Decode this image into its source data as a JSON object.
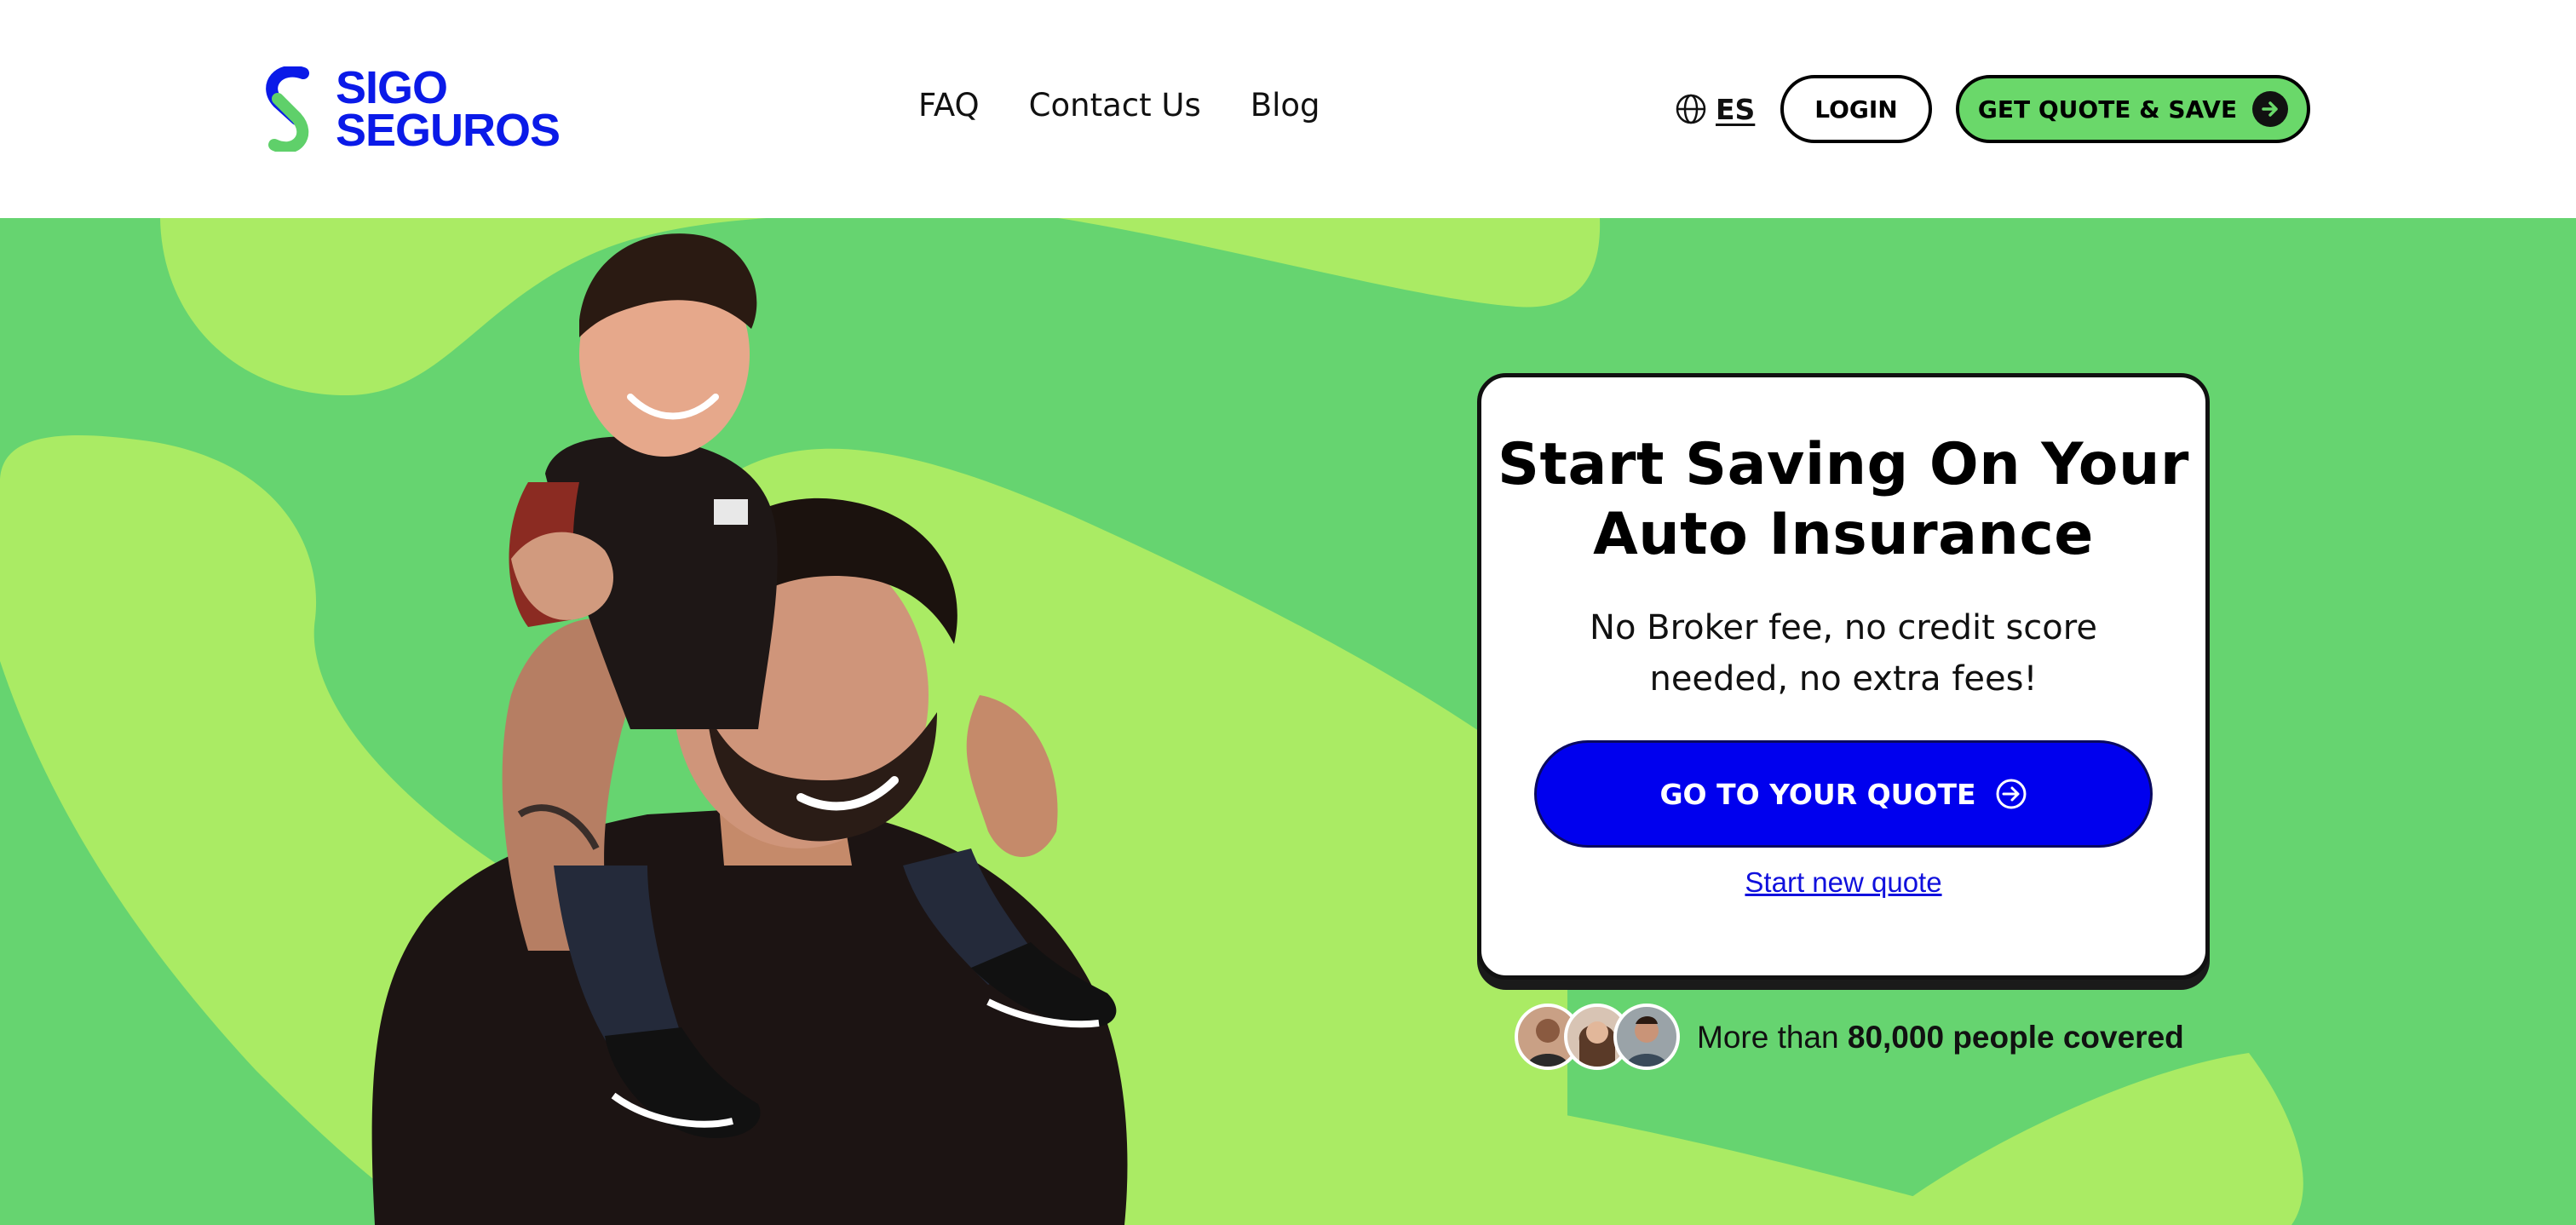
{
  "brand": {
    "line1": "SIGO",
    "line2": "SEGUROS"
  },
  "nav": [
    {
      "label": "FAQ"
    },
    {
      "label": "Contact Us"
    },
    {
      "label": "Blog"
    }
  ],
  "language": {
    "label": "ES",
    "icon": "globe-icon"
  },
  "header_buttons": {
    "login": "LOGIN",
    "quote": "GET QUOTE & SAVE",
    "quote_icon": "arrow-right-circle-icon"
  },
  "card": {
    "title_line1": "Start Saving On Your",
    "title_line2": "Auto Insurance",
    "subtitle_line1": "No Broker fee, no credit score",
    "subtitle_line2": "needed, no extra fees!",
    "cta": "GO TO YOUR QUOTE",
    "cta_icon": "arrow-right-circle-icon",
    "link": "Start new quote"
  },
  "covered": {
    "prefix": "More than",
    "emphasis": "80,000 people covered"
  },
  "colors": {
    "brand_blue": "#0a1ae8",
    "hero_green": "#66d470",
    "light_green": "#aaeb64",
    "cta_blue": "#0000ee",
    "quote_button_green": "#6ad86a"
  }
}
